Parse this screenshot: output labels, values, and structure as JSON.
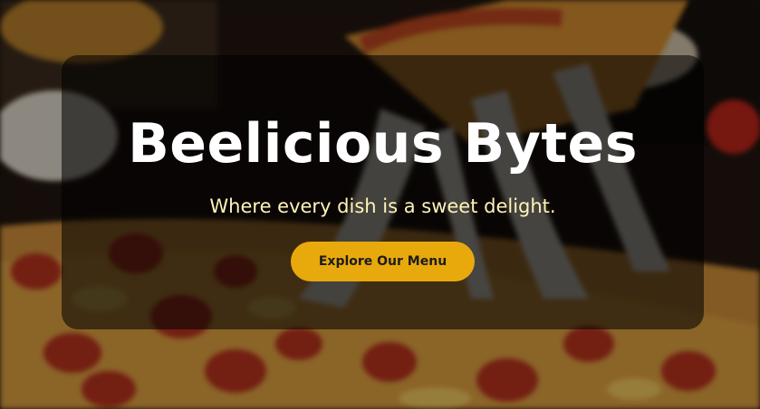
{
  "hero": {
    "title": "Beelicious Bytes",
    "tagline": "Where every dish is a sweet delight.",
    "cta_label": "Explore Our Menu",
    "background_image": "pizza-cheese-pull-photo"
  },
  "colors": {
    "accent": "#e8a90c",
    "tagline": "#fff3b8",
    "title": "#ffffff",
    "overlay": "rgba(0,0,0,0.55)"
  }
}
